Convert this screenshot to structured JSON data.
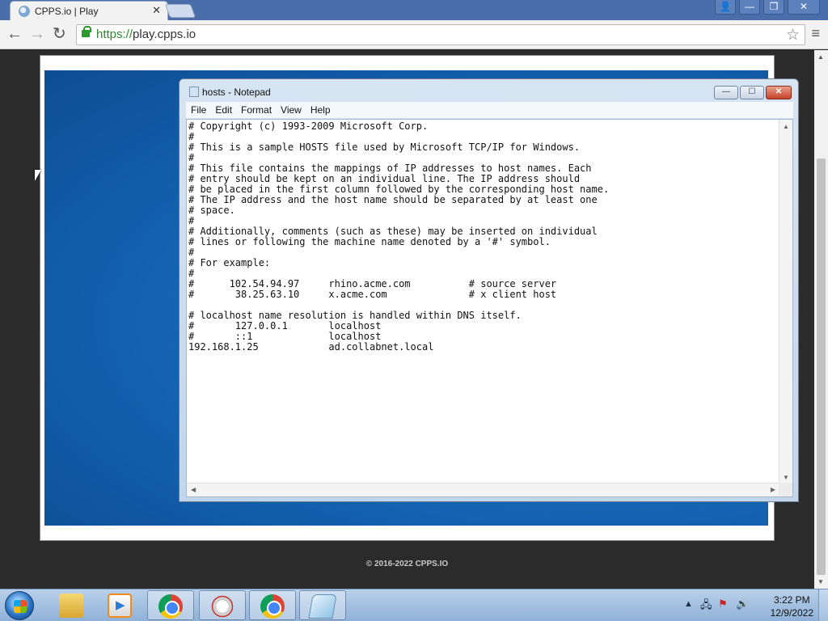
{
  "browser": {
    "tab_title": "CPPS.io | Play",
    "tab_close": "✕",
    "url_scheme": "https://",
    "url_host": "play.cpps.io",
    "back_icon": "←",
    "forward_icon": "→",
    "reload_icon": "↻",
    "star_icon": "☆",
    "menu_icon": "≡",
    "user_icon": "👤",
    "minimize_icon": "—",
    "restore_icon": "❐",
    "close_icon": "✕"
  },
  "page": {
    "copyright": "© 2016-2022 CPPS.IO"
  },
  "notepad": {
    "title": "hosts - Notepad",
    "menu": [
      "File",
      "Edit",
      "Format",
      "View",
      "Help"
    ],
    "content": "# Copyright (c) 1993-2009 Microsoft Corp.\n#\n# This is a sample HOSTS file used by Microsoft TCP/IP for Windows.\n#\n# This file contains the mappings of IP addresses to host names. Each\n# entry should be kept on an individual line. The IP address should\n# be placed in the first column followed by the corresponding host name.\n# The IP address and the host name should be separated by at least one\n# space.\n#\n# Additionally, comments (such as these) may be inserted on individual\n# lines or following the machine name denoted by a '#' symbol.\n#\n# For example:\n#\n#      102.54.94.97     rhino.acme.com          # source server\n#       38.25.63.10     x.acme.com              # x client host\n\n# localhost name resolution is handled within DNS itself.\n#\t127.0.0.1       localhost\n#\t::1             localhost\n192.168.1.25            ad.collabnet.local"
  },
  "taskbar": {
    "clock_time": "3:22 PM",
    "clock_date": "12/9/2022",
    "tray_arrow": "▲"
  },
  "colors": {
    "titlebar": "#4a6ea9",
    "desktop": "#1668b8",
    "url_green": "#2d8a2d"
  }
}
